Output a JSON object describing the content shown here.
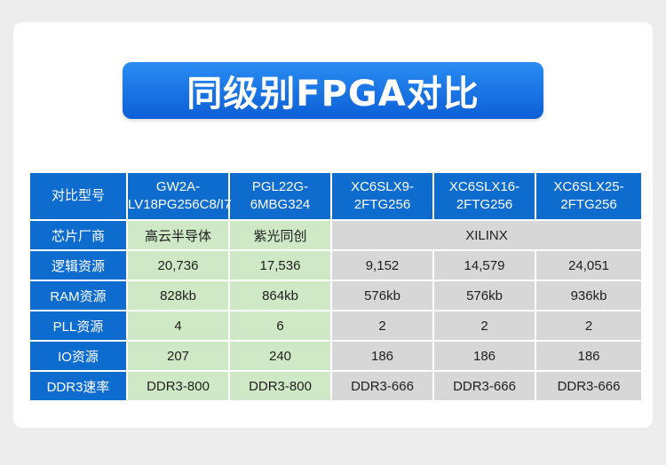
{
  "title": "同级别FPGA对比",
  "table": {
    "header": {
      "label": "对比型号",
      "models": [
        {
          "line1": "GW2A-",
          "line2": "LV18PG256C8/I7"
        },
        {
          "line1": "PGL22G-",
          "line2": "6MBG324"
        },
        {
          "line1": "XC6SLX9-",
          "line2": "2FTG256"
        },
        {
          "line1": "XC6SLX16-",
          "line2": "2FTG256"
        },
        {
          "line1": "XC6SLX25-",
          "line2": "2FTG256"
        }
      ]
    },
    "vendor": {
      "label": "芯片厂商",
      "gowin": "高云半导体",
      "pango": "紫光同创",
      "xilinx": "XILINX"
    },
    "rows": [
      {
        "label": "逻辑资源",
        "values": [
          "20,736",
          "17,536",
          "9,152",
          "14,579",
          "24,051"
        ]
      },
      {
        "label": "RAM资源",
        "values": [
          "828kb",
          "864kb",
          "576kb",
          "576kb",
          "936kb"
        ]
      },
      {
        "label": "PLL资源",
        "values": [
          "4",
          "6",
          "2",
          "2",
          "2"
        ]
      },
      {
        "label": "IO资源",
        "values": [
          "207",
          "240",
          "186",
          "186",
          "186"
        ]
      },
      {
        "label": "DDR3速率",
        "values": [
          "DDR3-800",
          "DDR3-800",
          "DDR3-666",
          "DDR3-666",
          "DDR3-666"
        ]
      }
    ]
  },
  "colors": {
    "header_blue": "#0f6ccf",
    "green_cell": "#cfe8c6",
    "gray_cell": "#d7d7d7"
  }
}
